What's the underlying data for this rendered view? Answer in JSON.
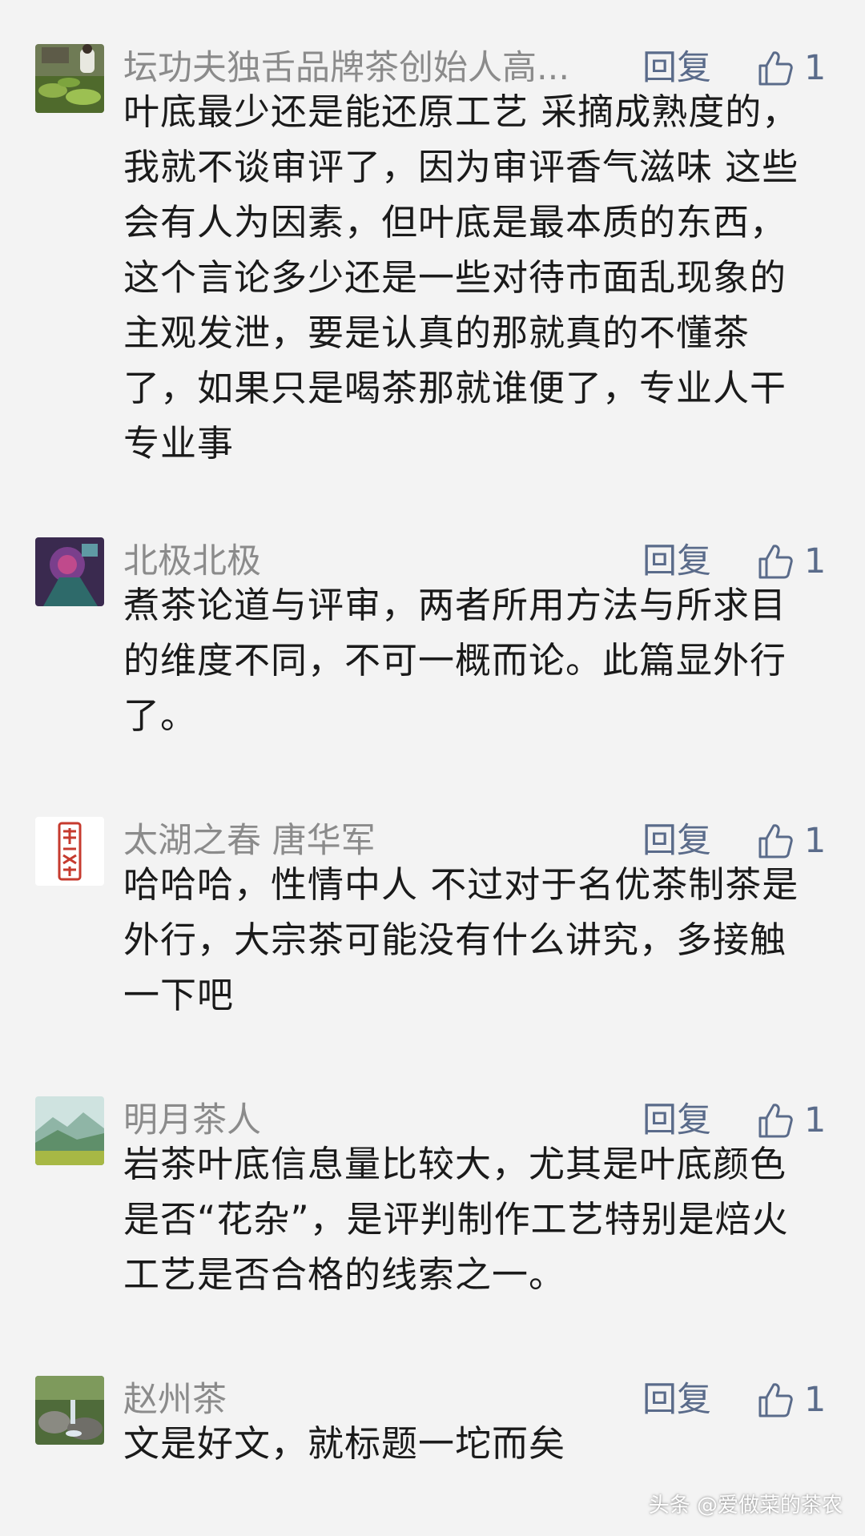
{
  "comments": [
    {
      "username": "坛功夫独舌品牌茶创始人高...",
      "reply_label": "回复",
      "like_count": "1",
      "content": "叶底最少还是能还原工艺 采摘成熟度的，我就不谈审评了，因为审评香气滋味 这些会有人为因素，但叶底是最本质的东西，这个言论多少还是一些对待市面乱现象的主观发泄，要是认真的那就真的不懂茶了，如果只是喝茶那就谁便了，专业人干专业事"
    },
    {
      "username": "北极北极",
      "reply_label": "回复",
      "like_count": "1",
      "content": "煮茶论道与评审，两者所用方法与所求目的维度不同，不可一概而论。此篇显外行了。"
    },
    {
      "username": "太湖之春 唐华军",
      "reply_label": "回复",
      "like_count": "1",
      "content": "哈哈哈，性情中人 不过对于名优茶制茶是外行，大宗茶可能没有什么讲究，多接触一下吧"
    },
    {
      "username": "明月茶人",
      "reply_label": "回复",
      "like_count": "1",
      "content": "岩茶叶底信息量比较大，尤其是叶底颜色是否“花杂”，是评判制作工艺特别是焙火工艺是否合格的线索之一。"
    },
    {
      "username": "赵州茶",
      "reply_label": "回复",
      "like_count": "1",
      "content": "文是好文，就标题一坨而矣"
    }
  ],
  "watermark": "头条 @爱做菜的茶农",
  "icons": {
    "like": "thumbs-up-icon"
  },
  "colors": {
    "background": "#f3f3f3",
    "username": "#8b8b8b",
    "action": "#5a6b8a",
    "text": "#1a1a1a"
  }
}
